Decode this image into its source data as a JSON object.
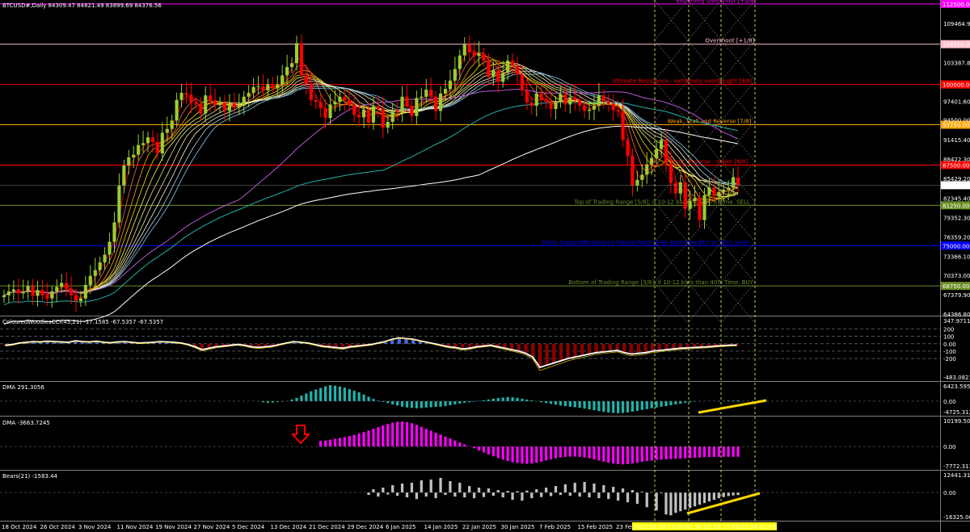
{
  "window": {
    "symbol_header": "BTCUSD#,Daily  84309.47 84821.49 83899.69 84376.56",
    "current_price": "84376.56"
  },
  "colors": {
    "background": "#000000",
    "bull": "#9acd32",
    "bear": "#ff0000",
    "cci_histogram": "#4169e1",
    "cci_line": "#ffffff",
    "dma1": "#20b2aa",
    "dma2": "#ff00ff",
    "bears": "#c0c0c0",
    "trend_annotation": "#ffd700",
    "ma200": "#ffffff",
    "ma100": "#20b2aa",
    "ma50": "#ba55d3"
  },
  "chart_data": {
    "type": "candlestick",
    "main": {
      "title": "BTCUSD#,Daily  84309.47 84821.49 83899.69 84376.56",
      "y_ticks": [
        "109464.9",
        "106250.00",
        "103387.80",
        "100000.00",
        "97401.60",
        "94500.00",
        "91415.40",
        "88422.30",
        "85429.20",
        "84376.56",
        "82345.40",
        "81250.00",
        "79352.30",
        "76359.20",
        "75000.00",
        "73366.10",
        "70373.00",
        "68750.00",
        "67379.90",
        "64386.80"
      ],
      "ylim": [
        64386.8,
        111600
      ],
      "close": [
        67300,
        67900,
        68200,
        67600,
        67800,
        68700,
        67200,
        68100,
        67300,
        66800,
        67900,
        68600,
        69200,
        68300,
        67300,
        66400,
        66800,
        68900,
        70300,
        71200,
        72400,
        73600,
        75600,
        78600,
        84300,
        87400,
        88700,
        89100,
        90600,
        90900,
        91800,
        91100,
        89300,
        92500,
        93100,
        94400,
        97600,
        98700,
        98400,
        97200,
        96900,
        95500,
        98300,
        97400,
        96800,
        97200,
        95900,
        97100,
        96400,
        96700,
        98100,
        98700,
        99600,
        99700,
        99100,
        100000,
        99400,
        100000,
        101400,
        102700,
        103300,
        106400,
        101400,
        100100,
        97600,
        97300,
        96300,
        94800,
        96900,
        97300,
        98100,
        97600,
        96800,
        95300,
        94900,
        96100,
        94100,
        96600,
        96200,
        93300,
        94200,
        96000,
        95800,
        98100,
        96600,
        95100,
        97900,
        98100,
        99200,
        98100,
        95900,
        98600,
        99300,
        100600,
        102400,
        104500,
        106200,
        105000,
        104400,
        104800,
        103700,
        101200,
        102200,
        100400,
        101800,
        103700,
        102900,
        101500,
        99100,
        97200,
        96700,
        98600,
        97600,
        97300,
        96200,
        97300,
        98500,
        96900,
        98000,
        97600,
        96700,
        95900,
        96100,
        96700,
        98300,
        97400,
        97100,
        96000,
        95800,
        91400,
        88900,
        84300,
        85200,
        86000,
        87600,
        88600,
        90000,
        91400,
        87800,
        84700,
        83100,
        84800,
        80700,
        81900,
        82400,
        79000,
        82800,
        84000,
        82700,
        83300,
        83700,
        84000,
        85600,
        84376.56
      ],
      "moving_averages": [
        {
          "period": "200",
          "color": "#ffffff"
        },
        {
          "period": "100",
          "color": "#20b2aa"
        },
        {
          "period": "50",
          "color": "#ba55d3"
        }
      ],
      "levels": [
        {
          "label": "Extremely Overshoot [+2/8]",
          "value": "112500.00",
          "color": "#ff00ff"
        },
        {
          "label": "Overshoot [+1/8]",
          "value": "106250.00",
          "color": "#ffc0cb"
        },
        {
          "label": "Ultimate Resistance - extremely overbought [8/8]",
          "value": "100000.00",
          "color": "#ff0000"
        },
        {
          "label": "Weak, Stall and Reverse [7/8]",
          "value": "93750.00",
          "color": "#ffa500"
        },
        {
          "label": "Pivot, Reverse - major [6/8]",
          "value": "87500.00",
          "color": "#ff0000"
        },
        {
          "label": "Top of Trading Range [5/8], if 10-12 bars than 40% Time. SELL",
          "value": "81250.00",
          "color": "#6b8e23"
        },
        {
          "label": "Major Support/Resistance Pivotal Point [4/8]- Best New BUY or SELL level",
          "value": "75000.00",
          "color": "#0000ff"
        },
        {
          "label": "Bottom of Trading Range [3/8], if 10-12 bars than 40% Time. BUY",
          "value": "68750.00",
          "color": "#6b8e23"
        }
      ]
    },
    "cci": {
      "title": "ColouredWoodiesCCI(45,21) -17.1585 -67.5357 -67.5357",
      "y_ticks": [
        "347.9711",
        "200",
        "100",
        "0.00",
        "-100",
        "-200",
        "-483.0821"
      ],
      "ylim": [
        -483.0821,
        347.9711
      ],
      "values": [
        -20,
        -10,
        10,
        20,
        30,
        25,
        35,
        30,
        25,
        20,
        40,
        30,
        25,
        35,
        20,
        15,
        25,
        30,
        20,
        10,
        15,
        20,
        30,
        25,
        20,
        10,
        -10,
        -40,
        -80,
        -60,
        -40,
        -30,
        -20,
        -10,
        -20,
        -40,
        -50,
        -40,
        -30,
        -10,
        10,
        30,
        20,
        10,
        -10,
        -30,
        -40,
        -50,
        -60,
        -40,
        -30,
        -20,
        -10,
        10,
        30,
        60,
        80,
        70,
        60,
        40,
        20,
        0,
        -20,
        -40,
        -50,
        -70,
        -60,
        -40,
        -30,
        -20,
        -40,
        -60,
        -80,
        -100,
        -130,
        -180,
        -320,
        -290,
        -260,
        -230,
        -200,
        -180,
        -160,
        -140,
        -120,
        -110,
        -100,
        -90,
        -120,
        -140,
        -130,
        -120,
        -100,
        -90,
        -80,
        -70,
        -60,
        -55,
        -50,
        -45,
        -40,
        -30,
        -25,
        -20,
        -17
      ]
    },
    "dma1": {
      "title": "DMA 291.3056",
      "y_ticks": [
        "6423.5956",
        "0.00",
        "-4725.3121"
      ],
      "ylim": [
        -4725.3121,
        6423.5956
      ],
      "values": [
        -400,
        -600,
        -500,
        -300,
        -200,
        100,
        600,
        1200,
        2000,
        2800,
        3600,
        4200,
        4800,
        5400,
        5800,
        5600,
        5300,
        4900,
        4400,
        3800,
        3200,
        2400,
        1600,
        800,
        200,
        -300,
        -700,
        -1200,
        -1600,
        -2000,
        -2300,
        -2500,
        -2600,
        -2500,
        -2300,
        -2200,
        -2100,
        -2000,
        -1800,
        -1500,
        -1200,
        -900,
        -600,
        -400,
        -200,
        100,
        300,
        600,
        900,
        1100,
        1300,
        1500,
        1400,
        1200,
        900,
        600,
        300,
        -100,
        -400,
        -700,
        -1000,
        -1300,
        -1600,
        -1800,
        -2000,
        -2200,
        -2400,
        -2700,
        -3000,
        -3300,
        -3600,
        -3900,
        -4100,
        -4300,
        -4400,
        -4300,
        -4100,
        -3800,
        -3500,
        -3200,
        -2900,
        -2600,
        -2300,
        -2000,
        -1800,
        -1500,
        -1200,
        -900,
        -600,
        -400,
        -200,
        -100,
        -50,
        0,
        50,
        100,
        150,
        200,
        250,
        291
      ],
      "trendline": "yellow rising"
    },
    "dma2": {
      "title": "DMA -3663.7245",
      "y_ticks": [
        "10199.5061",
        "0.00",
        "-7772.3134"
      ],
      "ylim": [
        -7772.3134,
        10199.5061
      ],
      "values": [
        2000,
        2200,
        2500,
        2800,
        3100,
        3400,
        3800,
        4200,
        4700,
        5200,
        5800,
        6400,
        7000,
        7600,
        8100,
        8600,
        8900,
        9000,
        8800,
        8400,
        7800,
        7100,
        6400,
        5700,
        5000,
        4300,
        3600,
        2900,
        2200,
        1500,
        800,
        100,
        -600,
        -1400,
        -2100,
        -2800,
        -3500,
        -4100,
        -4700,
        -5200,
        -5600,
        -5900,
        -6100,
        -6200,
        -6100,
        -5800,
        -5400,
        -5000,
        -4600,
        -4200,
        -3900,
        -3700,
        -3600,
        -3600,
        -3700,
        -3900,
        -4200,
        -4600,
        -5000,
        -5400,
        -5800,
        -6100,
        -6300,
        -6400,
        -6300,
        -6100,
        -5800,
        -5500,
        -5200,
        -5000,
        -4800,
        -4700,
        -4600,
        -4500,
        -4400,
        -4300,
        -4200,
        -4100,
        -4000,
        -3900,
        -3800,
        -3750,
        -3700,
        -3690,
        -3680,
        -3670,
        -3665,
        -3664
      ],
      "annotation": "red down arrow"
    },
    "bears": {
      "title": "Bears(21) -1583.44",
      "y_ticks": [
        "12441.31",
        "0.00",
        "-16325.06"
      ],
      "ylim": [
        -16325.06,
        12441.31
      ],
      "values": [
        -1500,
        2000,
        -2500,
        3000,
        -1200,
        4500,
        -2000,
        5500,
        -3000,
        6000,
        -4000,
        7500,
        -2500,
        8000,
        -3500,
        9000,
        -1500,
        7000,
        -2500,
        6000,
        -3000,
        4000,
        -3500,
        3000,
        -2800,
        2500,
        -2000,
        1500,
        -3000,
        1000,
        -4500,
        800,
        -5000,
        1200,
        -3500,
        2000,
        -2800,
        3000,
        -2200,
        4000,
        -1500,
        5000,
        -2000,
        6000,
        -2500,
        6500,
        -3000,
        5500,
        -3500,
        4500,
        -4000,
        3500,
        -5000,
        2500,
        -6000,
        1500,
        -7000,
        500,
        -9000,
        300,
        -11000,
        -500,
        -13500,
        -14000,
        -12500,
        -11500,
        -10500,
        -9500,
        -8500,
        -7500,
        -6500,
        -5500,
        -4500,
        -3500,
        -2800,
        -2200,
        -1800,
        -1583.44
      ],
      "trendline": "yellow rising"
    },
    "x_axis": {
      "tick_labels": [
        "18 Oct 2024",
        "26 Oct 2024",
        "3 Nov 2024",
        "11 Nov 2024",
        "19 Nov 2024",
        "27 Nov 2024",
        "5 Dec 2024",
        "13 Dec 2024",
        "21 Dec 2024",
        "29 Dec 2024",
        "6 Jan 2025",
        "14 Jan 2025",
        "22 Jan 2025",
        "30 Jan 2025",
        "7 Feb 2025",
        "15 Feb 2025",
        "23 Feb 2025"
      ],
      "highlight_labels": [
        "2025.03.03 03:00",
        "03.10 03:00",
        "03.17 03:00",
        "03.24 02:59"
      ]
    }
  }
}
